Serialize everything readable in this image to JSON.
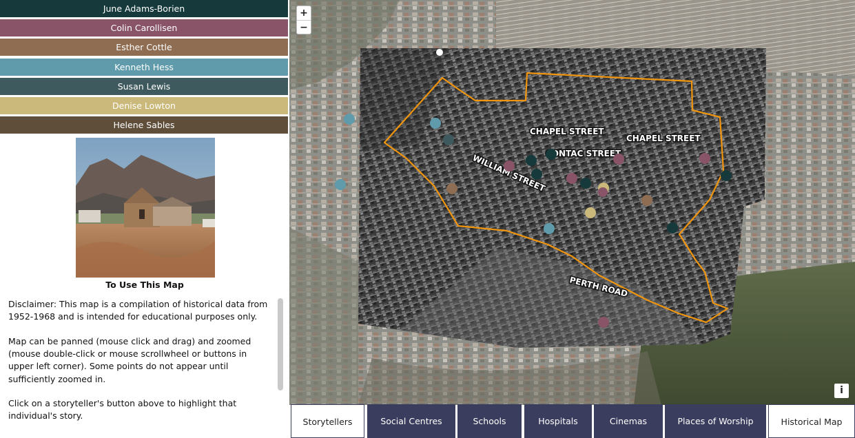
{
  "storytellers": [
    {
      "label": "June Adams-Borien",
      "color": "#163a3c"
    },
    {
      "label": "Colin Carollisen",
      "color": "#8a5468"
    },
    {
      "label": "Esther Cottle",
      "color": "#8f6d52"
    },
    {
      "label": "Kenneth Hess",
      "color": "#5f9bab"
    },
    {
      "label": "Susan Lewis",
      "color": "#3f5a5e"
    },
    {
      "label": "Denise Lowton",
      "color": "#cab97a"
    },
    {
      "label": "Helene Sables",
      "color": "#5e4e3a"
    }
  ],
  "info": {
    "title": "To Use This Map",
    "paragraphs": [
      "Disclaimer: This map is a compilation of historical data from 1952-1968 and is intended for educational purposes only.",
      "Map can be panned (mouse click and drag) and zoomed (mouse double-click or mouse scrollwheel or buttons in upper left corner). Some points do not appear until sufficiently zoomed in.",
      "Click on a storyteller's button above to highlight that individual's story."
    ]
  },
  "map": {
    "zoom_in": "+",
    "zoom_out": "−",
    "info_label": "i",
    "street_labels": [
      "CHAPEL STREET",
      "CHAPEL STREET",
      "CONTAC STREET",
      "WILLIAM STREET",
      "PERTH ROAD"
    ],
    "boundary_color": "#f0950d"
  },
  "tabs": [
    {
      "label": "Storytellers",
      "active": false
    },
    {
      "label": "Social Centres",
      "active": true
    },
    {
      "label": "Schools",
      "active": true
    },
    {
      "label": "Hospitals",
      "active": true
    },
    {
      "label": "Cinemas",
      "active": true
    },
    {
      "label": "Places of Worship",
      "active": true
    },
    {
      "label": "Historical Map",
      "active": false
    }
  ]
}
